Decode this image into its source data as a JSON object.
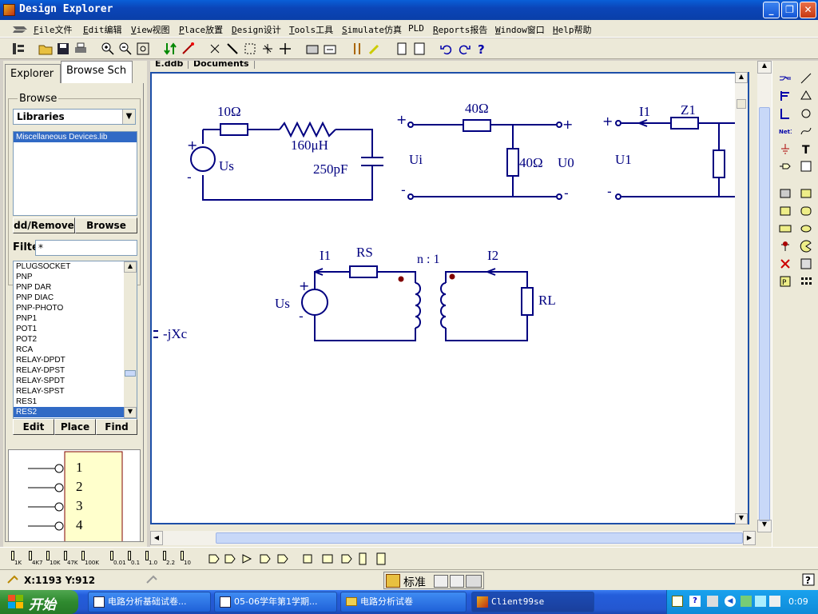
{
  "window": {
    "title": "Design Explorer"
  },
  "menu": [
    {
      "label": "File文件",
      "u": "F"
    },
    {
      "label": "Edit编辑",
      "u": "E"
    },
    {
      "label": "View视图",
      "u": "V"
    },
    {
      "label": "Place放置",
      "u": "P"
    },
    {
      "label": "Design设计",
      "u": "D"
    },
    {
      "label": "Tools工具",
      "u": "T"
    },
    {
      "label": "Simulate仿真",
      "u": "S"
    },
    {
      "label": "PLD",
      "u": ""
    },
    {
      "label": "Reports报告",
      "u": "R"
    },
    {
      "label": "Window窗口",
      "u": "W"
    },
    {
      "label": "Help帮助",
      "u": "H"
    }
  ],
  "left_panel": {
    "tabs": [
      "Explorer",
      "Browse Sch"
    ],
    "browse_label": "Browse",
    "browse_select": "Libraries",
    "libraries": [
      "Miscellaneous Devices.lib"
    ],
    "add_remove_label": "dd/Remove",
    "browse_button": "Browse",
    "filter_label": "Filte",
    "filter_value": "*",
    "components": [
      "PLUGSOCKET",
      "PNP",
      "PNP DAR",
      "PNP DIAC",
      "PNP-PHOTO",
      "PNP1",
      "POT1",
      "POT2",
      "RCA",
      "RELAY-DPDT",
      "RELAY-DPST",
      "RELAY-SPDT",
      "RELAY-SPST",
      "RES1",
      "RES2"
    ],
    "selected_component": "RES2",
    "edit_button": "Edit",
    "place_button": "Place",
    "find_button": "Find",
    "preview_pins": [
      "1",
      "2",
      "3",
      "4"
    ]
  },
  "doc_tabs": [
    "E.ddb",
    "Documents"
  ],
  "schematic": {
    "c1": {
      "r": "10Ω",
      "l": "160μH",
      "c": "250pF",
      "source": "Us",
      "plus": "+",
      "minus": "-"
    },
    "c2": {
      "r1": "40Ω",
      "r2": "40Ω",
      "ui": "Ui",
      "u0": "U0",
      "plus": "+",
      "minus": "-"
    },
    "c3": {
      "i1": "I1",
      "z1": "Z1",
      "u1": "U1",
      "plus": "+",
      "minus": "-"
    },
    "c4": {
      "i1": "I1",
      "rs": "RS",
      "ratio": "n : 1",
      "i2": "I2",
      "rl": "RL",
      "source": "Us",
      "plus": "+",
      "minus": "-"
    },
    "partial_label": "-jXc"
  },
  "status": {
    "coords": "X:1193 Y:912"
  },
  "ime": {
    "mode": "标准"
  },
  "taskbar": {
    "start": "开始",
    "tasks": [
      "电路分析基础试卷...",
      "05-06学年第1学期...",
      "电路分析试卷",
      "Client99se"
    ],
    "clock": "0:09"
  },
  "bottom_parts": [
    "1K",
    "4K7",
    "10K",
    "47K",
    "100K",
    "0.01",
    "0.1",
    "1.0",
    "2.2",
    "10"
  ]
}
